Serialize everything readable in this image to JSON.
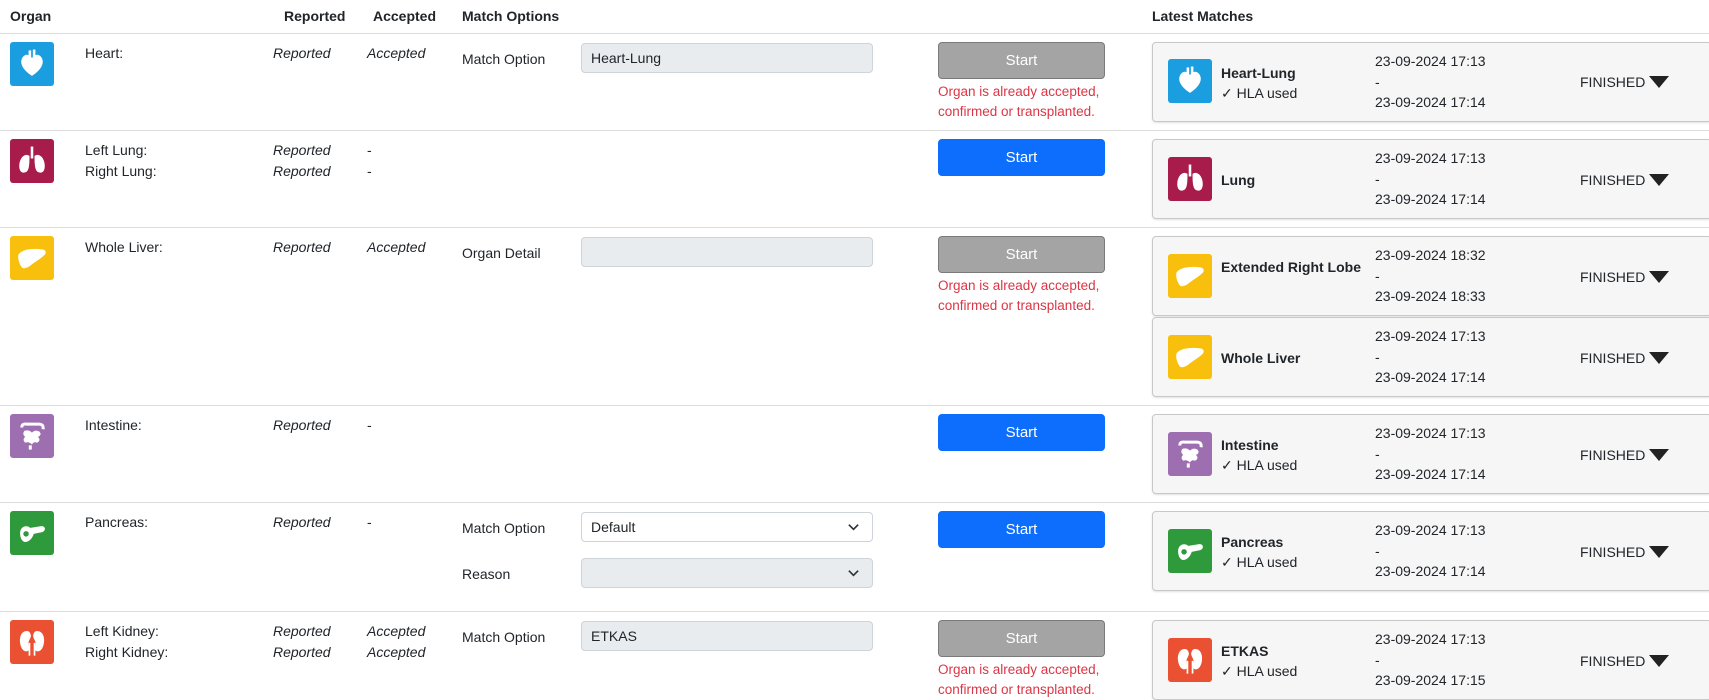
{
  "headers": {
    "organ": "Organ",
    "reported": "Reported",
    "accepted": "Accepted",
    "match_options": "Match Options",
    "latest_matches": "Latest Matches"
  },
  "colors": {
    "heart": "#1a9ee0",
    "lung": "#a71c4a",
    "liver": "#f9bf0d",
    "intestine": "#9d6fb0",
    "pancreas": "#2f9a3b",
    "kidney": "#ea5133",
    "primary": "#0d6efd",
    "disabled": "#a4a4a4",
    "error": "#dc3545"
  },
  "rows": [
    {
      "icon": "heart-icon",
      "organs": [
        "Heart:"
      ],
      "reported": [
        "Reported"
      ],
      "accepted": [
        "Accepted"
      ],
      "options": [
        {
          "label": "Match Option",
          "value": "Heart-Lung",
          "type": "readonly"
        }
      ],
      "button": {
        "label": "Start",
        "enabled": false
      },
      "error": [
        "Organ is already accepted,",
        "confirmed or transplanted."
      ],
      "matches": [
        {
          "icon": "heart-icon",
          "name": "Heart-Lung",
          "hla": "✓ HLA used",
          "start": "23-09-2024 17:13",
          "sep": "-",
          "end": "23-09-2024 17:14",
          "status": "FINISHED"
        }
      ]
    },
    {
      "icon": "lung-icon",
      "organs": [
        "Left Lung:",
        "Right Lung:"
      ],
      "reported": [
        "Reported",
        "Reported"
      ],
      "accepted": [
        "-",
        "-"
      ],
      "options": [],
      "button": {
        "label": "Start",
        "enabled": true
      },
      "error": [],
      "matches": [
        {
          "icon": "lung-icon",
          "name": "Lung",
          "hla": "",
          "start": "23-09-2024 17:13",
          "sep": "-",
          "end": "23-09-2024 17:14",
          "status": "FINISHED"
        }
      ]
    },
    {
      "icon": "liver-icon",
      "organs": [
        "Whole Liver:"
      ],
      "reported": [
        "Reported"
      ],
      "accepted": [
        "Accepted"
      ],
      "options": [
        {
          "label": "Organ Detail",
          "value": "",
          "type": "readonly"
        }
      ],
      "button": {
        "label": "Start",
        "enabled": false
      },
      "error": [
        "Organ is already accepted,",
        "confirmed or transplanted."
      ],
      "matches": [
        {
          "icon": "liver-icon",
          "name": "Extended Right Lobe",
          "hla": "",
          "start": "23-09-2024 18:32",
          "sep": "-",
          "end": "23-09-2024 18:33",
          "status": "FINISHED"
        },
        {
          "icon": "liver-icon",
          "name": "Whole Liver",
          "hla": "",
          "start": "23-09-2024 17:13",
          "sep": "-",
          "end": "23-09-2024 17:14",
          "status": "FINISHED"
        }
      ]
    },
    {
      "icon": "intestine-icon",
      "organs": [
        "Intestine:"
      ],
      "reported": [
        "Reported"
      ],
      "accepted": [
        "-"
      ],
      "options": [],
      "button": {
        "label": "Start",
        "enabled": true
      },
      "error": [],
      "matches": [
        {
          "icon": "intestine-icon",
          "name": "Intestine",
          "hla": "✓ HLA used",
          "start": "23-09-2024 17:13",
          "sep": "-",
          "end": "23-09-2024 17:14",
          "status": "FINISHED"
        }
      ]
    },
    {
      "icon": "pancreas-icon",
      "organs": [
        "Pancreas:"
      ],
      "reported": [
        "Reported"
      ],
      "accepted": [
        "-"
      ],
      "options": [
        {
          "label": "Match Option",
          "value": "Default",
          "type": "select"
        },
        {
          "label": "Reason",
          "value": "",
          "type": "select-disabled"
        }
      ],
      "button": {
        "label": "Start",
        "enabled": true
      },
      "error": [],
      "matches": [
        {
          "icon": "pancreas-icon",
          "name": "Pancreas",
          "hla": "✓ HLA used",
          "start": "23-09-2024 17:13",
          "sep": "-",
          "end": "23-09-2024 17:14",
          "status": "FINISHED"
        }
      ]
    },
    {
      "icon": "kidney-icon",
      "organs": [
        "Left Kidney:",
        "Right Kidney:"
      ],
      "reported": [
        "Reported",
        "Reported"
      ],
      "accepted": [
        "Accepted",
        "Accepted"
      ],
      "options": [
        {
          "label": "Match Option",
          "value": "ETKAS",
          "type": "readonly"
        }
      ],
      "button": {
        "label": "Start",
        "enabled": false
      },
      "error": [
        "Organ is already accepted,",
        "confirmed or transplanted."
      ],
      "matches": [
        {
          "icon": "kidney-icon",
          "name": "ETKAS",
          "hla": "✓ HLA used",
          "start": "23-09-2024 17:13",
          "sep": "-",
          "end": "23-09-2024 17:15",
          "status": "FINISHED"
        }
      ]
    }
  ]
}
